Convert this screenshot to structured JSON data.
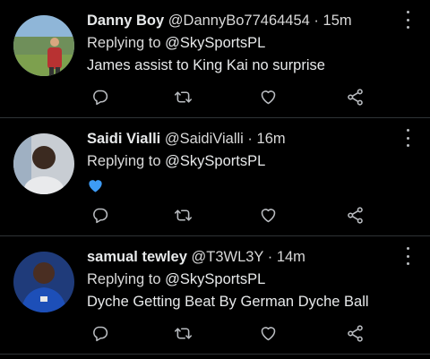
{
  "tweets": [
    {
      "name": "Danny Boy",
      "handle": "@DannyBo77464454",
      "separator": "·",
      "time": "15m",
      "replying_prefix": "Replying to",
      "replying_to": "@SkySportsPL",
      "text": "James assist to King Kai no surprise"
    },
    {
      "name": "Saidi Vialli",
      "handle": "@SaidiVialli",
      "separator": "·",
      "time": "16m",
      "replying_prefix": "Replying to",
      "replying_to": "@SkySportsPL",
      "text": "",
      "emoji": "blue-heart"
    },
    {
      "name": "samual tewley",
      "handle": "@T3WL3Y",
      "separator": "·",
      "time": "14m",
      "replying_prefix": "Replying to",
      "replying_to": "@SkySportsPL",
      "text": "Dyche Getting Beat By German Dyche Ball"
    }
  ],
  "colors": {
    "background": "#000000",
    "text": "#e7e9ea",
    "secondary": "#d9d9d9",
    "icon": "#b9bcc0",
    "divider": "#2f3336",
    "blue_heart": "#3d9bf5"
  },
  "icons": [
    "reply-icon",
    "retweet-icon",
    "like-icon",
    "share-icon",
    "more-icon"
  ]
}
